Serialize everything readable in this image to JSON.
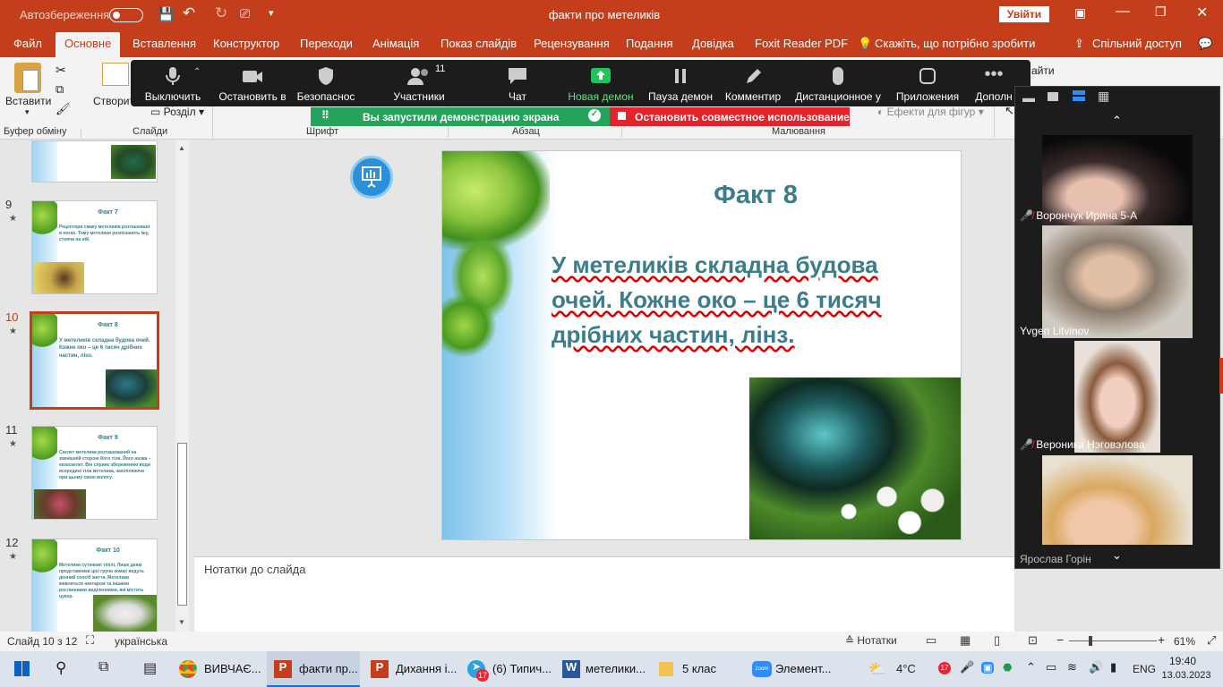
{
  "titlebar": {
    "autosave": "Автозбереження",
    "doc_title": "факти про метеликів",
    "signin": "Увійти"
  },
  "tabs": [
    "Файл",
    "Основне",
    "Вставлення",
    "Конструктор",
    "Переходи",
    "Анімація",
    "Показ слайдів",
    "Рецензування",
    "Подання",
    "Довідка",
    "Foxit Reader PDF"
  ],
  "tellme": "Скажіть, що потрібно зробити",
  "share": "Спільний доступ",
  "ribbon": {
    "paste": "Вставити",
    "create_slide": "Створити слайд",
    "section": "Розділ",
    "clipboard": "Буфер обміну",
    "slides": "Слайди",
    "font": "Шрифт",
    "paragraph": "Абзац",
    "drawing": "Малювання",
    "effects": "Ефекти для фігур",
    "find": "айти"
  },
  "zoom": {
    "mute": "Выключить",
    "video": "Остановить в",
    "security": "Безопаснос",
    "participants": "Участники",
    "participants_count": "11",
    "chat": "Чат",
    "new_share": "Новая демон",
    "pause": "Пауза демон",
    "annotate": "Комментир",
    "remote": "Дистанционное у",
    "apps": "Приложения",
    "more": "Дополн"
  },
  "share_banner": "Вы запустили демонстрацию экрана",
  "stop_share": "Остановить совместное использование",
  "thumbs": [
    {
      "num": "9",
      "title": "Факт 7",
      "text": "Рецептори смаку метеликів розташовані в ногах. Тому метелики розпізнають їжу, стоячи на ній."
    },
    {
      "num": "10",
      "title": "Факт 8",
      "text": "У метеликів складна будова очей. Кожне око – це 6 тисяч дрібних частин, лінз."
    },
    {
      "num": "11",
      "title": "Факт 9",
      "text": "Скелет метелика розташований на зовнішній стороні його тіла. Його назва – екзоскелет. Він сприяє збереженню води всередині тіла метелика, захоплюючи при цьому свою вологу."
    },
    {
      "num": "12",
      "title": "Факт 10",
      "text": "Метелики сутінкові тіпілі. Лише деякі представники цієї групи комах ведуть денний спосіб життя. Метелики живляться нектаром та іншими рослинними виділеннями, які містять цукор."
    }
  ],
  "slide": {
    "title": "Факт 8",
    "body_line1": "У метеликів складна будова",
    "body_line2": "очей. Кожне око – це 6 тисяч",
    "body_line3": "дрібних частин, лінз."
  },
  "notes_placeholder": "Нотатки до слайда",
  "status": {
    "slide_info": "Слайд 10 з 12",
    "language": "українська",
    "notes_btn": "Нотатки",
    "zoom_level": "61%"
  },
  "participants": [
    {
      "name": "Ворончук Ирина 5-А",
      "muted": true
    },
    {
      "name": "Yvgen Litvinov",
      "muted": false
    },
    {
      "name": "Вероника Нэговэлова",
      "muted": true
    },
    {
      "name": "Ярослав Горін",
      "muted": false
    }
  ],
  "taskbar": {
    "apps": [
      "ВИВЧАЄ...",
      "факти пр...",
      "Дихання і...",
      "(6) Типич...",
      "метелики...",
      "5 клас",
      "Элемент..."
    ],
    "badge": "17",
    "weather": "4°C",
    "lang": "ENG",
    "time": "19:40",
    "date": "13.03.2023"
  },
  "colors": {
    "ppt_accent": "#c43e1c",
    "slide_text": "#3b7d8a",
    "zoom_green": "#25a35a",
    "zoom_red": "#e5232b"
  }
}
